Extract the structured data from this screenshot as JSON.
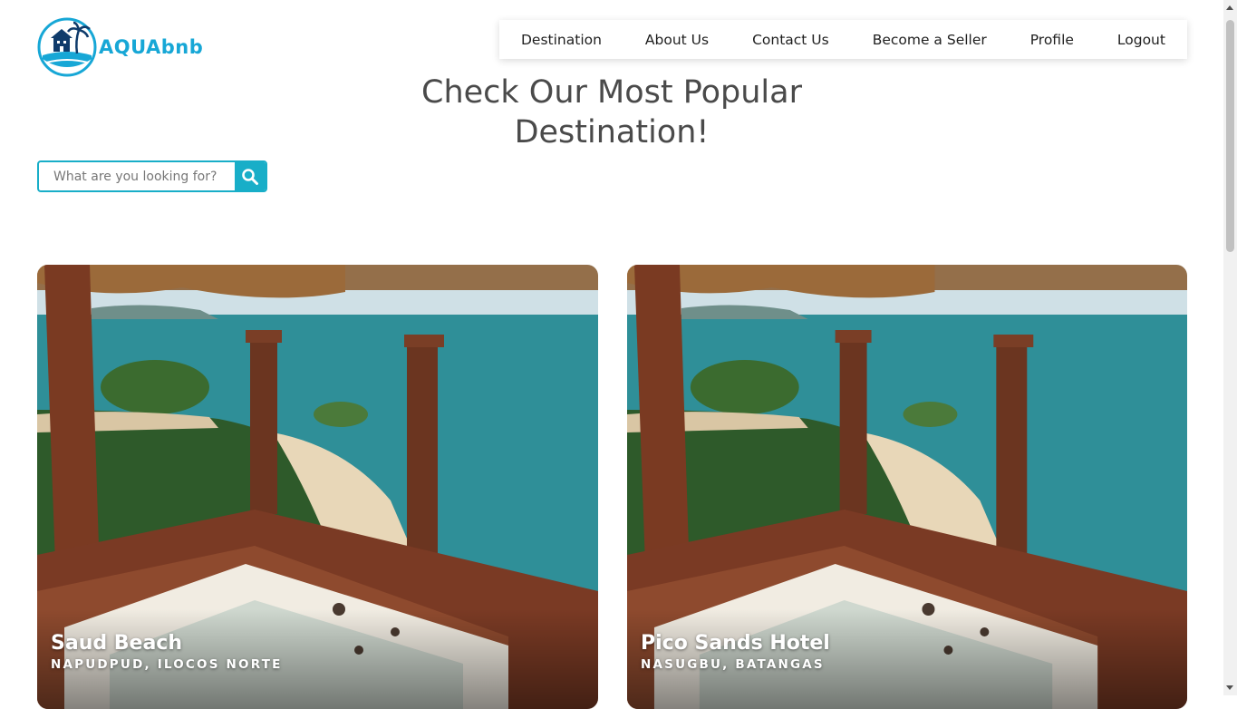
{
  "brand": {
    "name": "AQUAbnb",
    "accent": "#17a7d6"
  },
  "nav": {
    "items": [
      {
        "label": "Destination"
      },
      {
        "label": "About Us"
      },
      {
        "label": "Contact Us"
      },
      {
        "label": "Become a Seller"
      },
      {
        "label": "Profile"
      },
      {
        "label": "Logout"
      }
    ]
  },
  "main": {
    "heading_line1": "Check Our Most Popular",
    "heading_line2": "Destination!",
    "search": {
      "placeholder": "What are you looking for?",
      "icon": "search-icon"
    },
    "cards": [
      {
        "name": "Saud Beach",
        "location": "NAPUDPUD, ILOCOS NORTE"
      },
      {
        "name": "Pico Sands Hotel",
        "location": "NASUGBU, BATANGAS"
      }
    ]
  }
}
